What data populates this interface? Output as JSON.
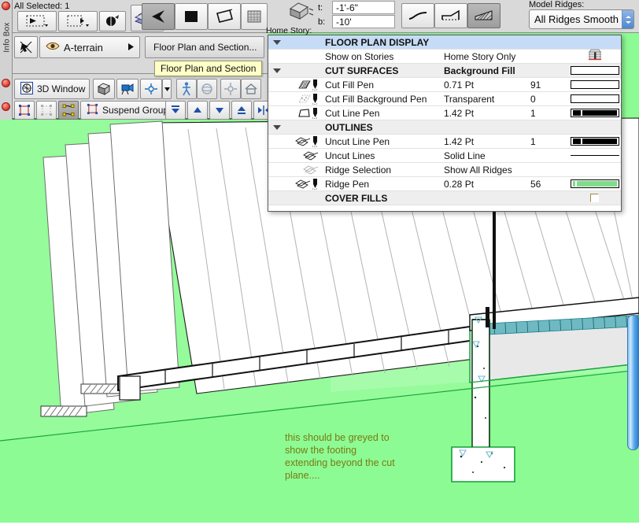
{
  "app": {
    "info_box_label": "Info Box",
    "selection_status": "All Selected: 1"
  },
  "toolbar": {
    "top_row": {
      "elevation_top_label": "t:",
      "elevation_top_value": "-1'-6\"",
      "elevation_bottom_label": "b:",
      "elevation_bottom_value": "-10'",
      "model_ridges_label": "Model Ridges:",
      "model_ridges_value": "All Ridges Smooth",
      "icons": [
        "marquee-select-icon",
        "marquee-offset-icon",
        "fill-bucket-icon",
        "mesh-stack-icon",
        "polyline-corner-icon",
        "rectangle-icon",
        "rotated-rectangle-icon",
        "grid-mesh-icon",
        "mesh-box-icon",
        "smooth-curve-icon",
        "ridged-curve-icon",
        "hatched-slope-icon"
      ]
    },
    "second_row": {
      "home_story_label": "Home Story:",
      "layer_name": "A-terrain",
      "settings_button": "Floor Plan and Section...",
      "tooltip": "Floor Plan and Section",
      "icons": [
        "pointer-arrow-icon",
        "eye-icon",
        "chevron-right-icon"
      ]
    },
    "third_row": {
      "window_button": "3D Window",
      "icons": [
        "globe-3d-icon",
        "cube-icon",
        "camera-icon",
        "axis-move-icon",
        "chevron-down-icon",
        "walk-icon",
        "orbit-icon",
        "target-icon",
        "home-icon",
        "sparkle-walk-icon",
        "sparkle-cube-icon"
      ]
    },
    "fourth_row": {
      "groups_button": "Suspend Groups",
      "icons": [
        "group-icon",
        "ungroup-icon",
        "edit-group-icon",
        "suspend-group-icon",
        "send-to-back-icon",
        "send-backward-icon",
        "bring-forward-icon",
        "bring-to-front-icon",
        "align-icon"
      ]
    }
  },
  "dialog": {
    "title": "FLOOR PLAN DISPLAY",
    "rows": [
      {
        "kind": "header",
        "triangle": true,
        "icons": [],
        "name": "FLOOR PLAN DISPLAY",
        "value": "",
        "num": "",
        "swatch": "none"
      },
      {
        "kind": "plain",
        "triangle": false,
        "icons": [],
        "name": "Show on Stories",
        "value": "Home Story Only",
        "num": "",
        "swatch": "story-icon"
      },
      {
        "kind": "section",
        "triangle": true,
        "icons": [],
        "name": "CUT SURFACES",
        "value": "Background Fill",
        "num": "",
        "swatch": "white-box"
      },
      {
        "kind": "plain",
        "triangle": false,
        "icons": [
          "hatch-icon",
          "pen-icon"
        ],
        "name": "Cut Fill Pen",
        "value": "0.71 Pt",
        "num": "91",
        "swatch": "white-box"
      },
      {
        "kind": "plain",
        "triangle": false,
        "icons": [
          "dots-icon",
          "pen-icon"
        ],
        "name": "Cut Fill Background Pen",
        "value": "Transparent",
        "num": "0",
        "swatch": "white-box"
      },
      {
        "kind": "plain",
        "triangle": false,
        "icons": [
          "cutshape-icon",
          "pen-icon"
        ],
        "name": "Cut Line Pen",
        "value": "1.42 Pt",
        "num": "1",
        "swatch": "black-pen"
      },
      {
        "kind": "section",
        "triangle": true,
        "icons": [],
        "name": "OUTLINES",
        "value": "",
        "num": "",
        "swatch": "none"
      },
      {
        "kind": "plain",
        "triangle": false,
        "icons": [
          "roof-icon",
          "pen-icon"
        ],
        "name": "Uncut Line Pen",
        "value": "1.42 Pt",
        "num": "1",
        "swatch": "black-pen"
      },
      {
        "kind": "plain",
        "triangle": false,
        "icons": [
          "roof-line-icon"
        ],
        "name": "Uncut Lines",
        "value": "Solid Line",
        "num": "",
        "swatch": "solid-line"
      },
      {
        "kind": "plain",
        "triangle": false,
        "icons": [
          "ridge-gray-icon"
        ],
        "name": "Ridge Selection",
        "value": "Show All Ridges",
        "num": "",
        "swatch": "none"
      },
      {
        "kind": "plain",
        "triangle": false,
        "icons": [
          "ridge-icon",
          "pen-icon"
        ],
        "name": "Ridge Pen",
        "value": "0.28 Pt",
        "num": "56",
        "swatch": "green-pen"
      },
      {
        "kind": "section",
        "triangle": false,
        "icons": [],
        "name": "COVER FILLS",
        "value": "",
        "num": "",
        "swatch": "checkbox"
      }
    ]
  },
  "canvas": {
    "annotation": "this should be greyed to\nshow the footing\nextending beyond the cut\nplane....",
    "terrain_color": "#8dfb93",
    "annotation_color": "#7a7a14",
    "scrollbar": "vertical-scrollbar"
  },
  "colors": {
    "header_blue": "#c6dcf6",
    "section_gray": "#eeeeee",
    "chrome_gray": "#d9d9d9",
    "ridge_green": "#7fdc8a",
    "scroll_blue": "#4f9fe0"
  }
}
